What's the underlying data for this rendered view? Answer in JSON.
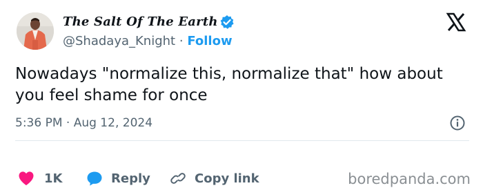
{
  "author": {
    "display_name": "The Salt Of The Earth",
    "handle": "@Shadaya_Knight",
    "separator": "·",
    "follow_label": "Follow",
    "verified": true
  },
  "tweet": {
    "text": "Nowadays \"normalize this, normalize that\" how about you feel shame for once",
    "timestamp": "5:36 PM · Aug 12, 2024"
  },
  "actions": {
    "like_count": "1K",
    "reply_label": "Reply",
    "copy_link_label": "Copy link"
  },
  "watermark": "boredpanda.com",
  "colors": {
    "accent": "#1d9bf0",
    "like": "#f91880",
    "text": "#0f1419",
    "secondary": "#536471",
    "divider": "#e1e8ed"
  },
  "icons": {
    "verified": "verified-badge-icon",
    "platform": "x-logo-icon",
    "info": "info-icon",
    "like": "heart-icon",
    "reply": "speech-bubble-icon",
    "copy": "link-icon"
  }
}
